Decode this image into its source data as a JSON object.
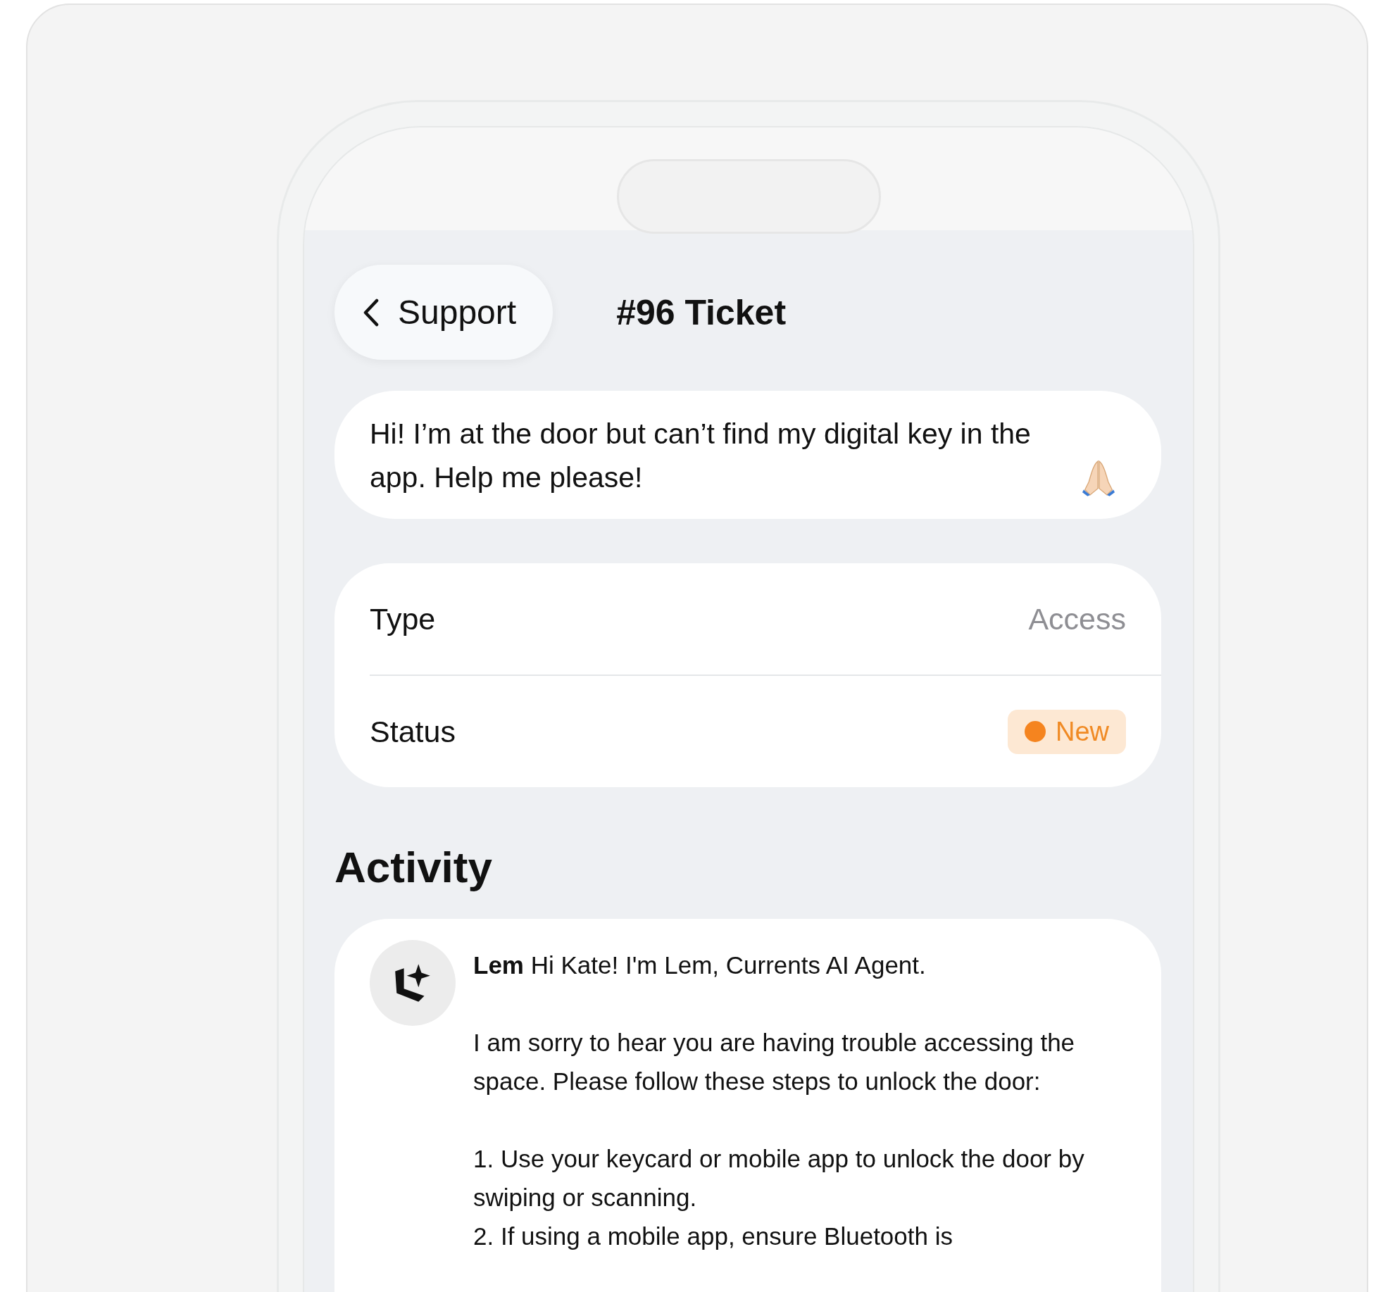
{
  "header": {
    "back_button": "Support",
    "title": "#96 Ticket"
  },
  "message": {
    "text": "Hi! I’m at the door but can’t find my digital key in the app. Help me please!"
  },
  "details": [
    {
      "kind": "text",
      "label": "Type",
      "value": "Access"
    },
    {
      "kind": "badge",
      "label": "Status",
      "value": "New"
    }
  ],
  "activity": {
    "heading": "Activity",
    "entries": [
      {
        "intro": "**Lem** Hi Kate! I'm Lem, Currents AI Agent.",
        "paragraphs": [
          "I am sorry to hear you are having trouble accessing the space. Please follow these steps to unlock the door:"
        ],
        "steps": [
          "1. Use your keycard or mobile app to unlock the door by swiping or scanning.",
          "2. If using a mobile app, ensure Bluetooth is"
        ]
      }
    ]
  }
}
